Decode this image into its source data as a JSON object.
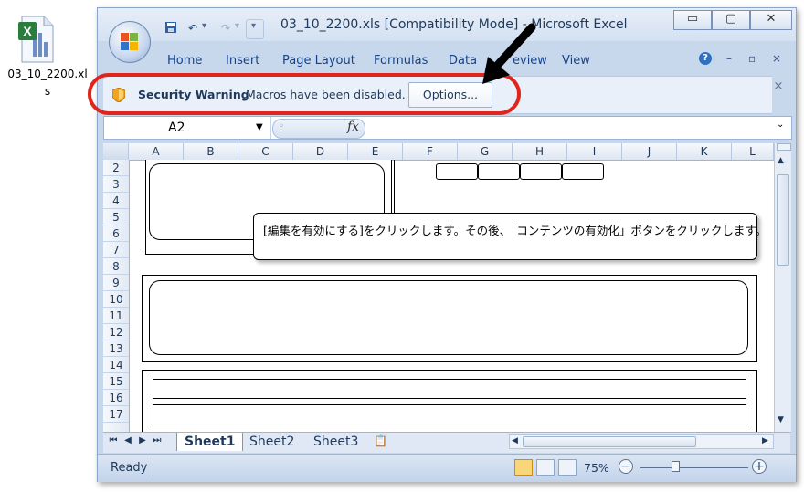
{
  "desktop": {
    "file_label_line1": "03_10_2200.xl",
    "file_label_line2": "s"
  },
  "window": {
    "title": "03_10_2200.xls  [Compatibility Mode] - Microsoft Excel",
    "title_visible": "03_10_2200.xls  [Compatibility Mode] - Microsoft Excel",
    "controls": {
      "minimize": "▭",
      "maximize": "▢",
      "close": "✕"
    }
  },
  "ribbon": {
    "tabs": [
      "Home",
      "Insert",
      "Page Layout",
      "Formulas",
      "Data",
      "Review",
      "View"
    ],
    "tabs_visible": [
      "Home",
      "Insert",
      "Page Layout",
      "Formulas",
      "Data",
      "eview",
      "View"
    ]
  },
  "security_bar": {
    "title": "Security Warning",
    "message": "Macros have been disabled.",
    "options_label": "Options..."
  },
  "formula_bar": {
    "name_box": "A2",
    "fx_label": "fx"
  },
  "grid": {
    "columns": [
      "A",
      "B",
      "C",
      "D",
      "E",
      "F",
      "G",
      "H",
      "I",
      "J",
      "K",
      "L"
    ],
    "rows": [
      "2",
      "3",
      "4",
      "5",
      "6",
      "7",
      "8",
      "9",
      "10",
      "11",
      "12",
      "13",
      "14",
      "15",
      "16",
      "17"
    ],
    "callout_text": "[編集を有効にする]をクリックします。その後、「コンテンツの有効化」ボタンをクリックします。"
  },
  "sheets": [
    "Sheet1",
    "Sheet2",
    "Sheet3"
  ],
  "active_sheet": "Sheet1",
  "status": {
    "text": "Ready",
    "zoom": "75%"
  },
  "colors": {
    "highlight_ring": "#e0261c",
    "chrome": "#c7d8ed",
    "text": "#15428b"
  }
}
